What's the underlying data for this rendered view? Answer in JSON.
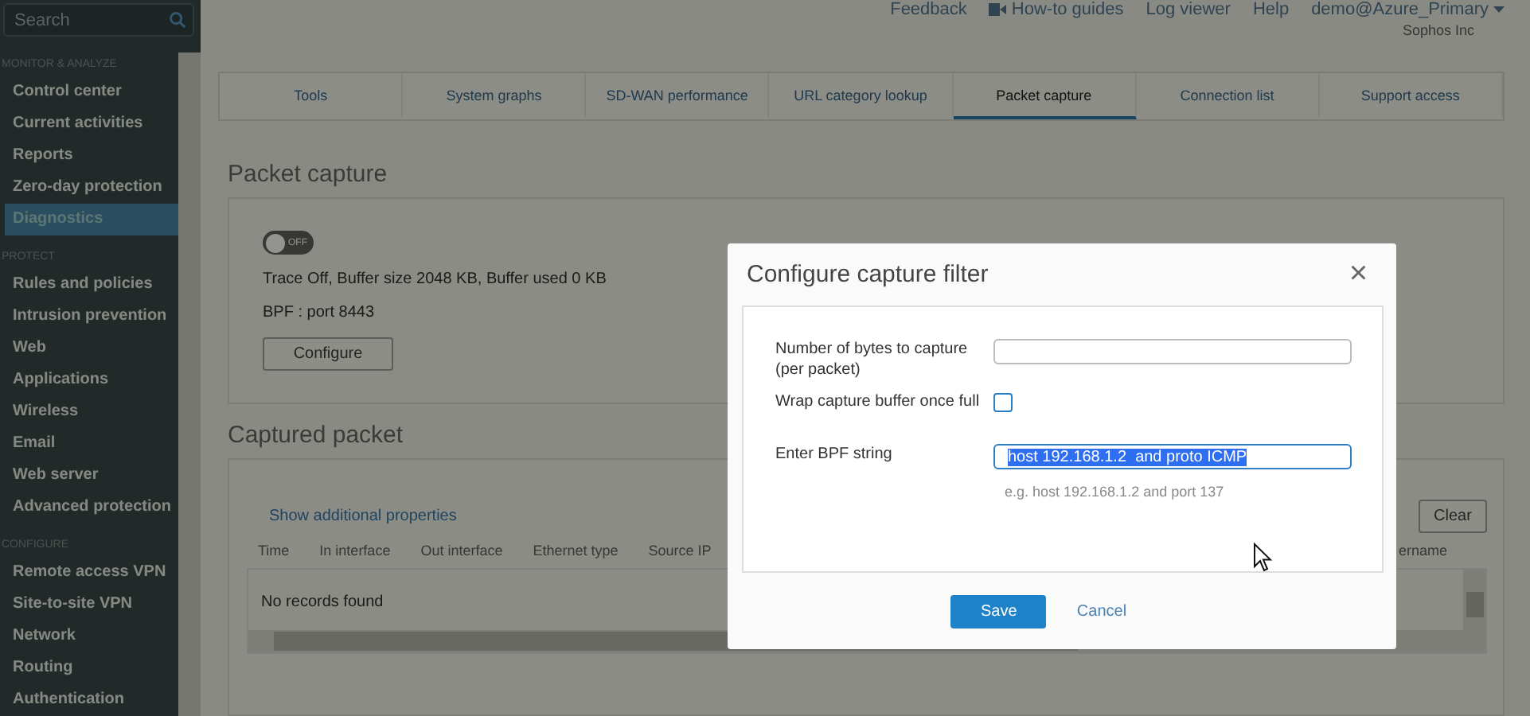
{
  "sidebar": {
    "search": {
      "placeholder": "Search"
    },
    "sections": [
      {
        "label": "MONITOR & ANALYZE",
        "items": [
          {
            "label": "Control center",
            "selected": false
          },
          {
            "label": "Current activities",
            "selected": false
          },
          {
            "label": "Reports",
            "selected": false
          },
          {
            "label": "Zero-day protection",
            "selected": false
          },
          {
            "label": "Diagnostics",
            "selected": true
          }
        ]
      },
      {
        "label": "PROTECT",
        "items": [
          {
            "label": "Rules and policies",
            "selected": false
          },
          {
            "label": "Intrusion prevention",
            "selected": false
          },
          {
            "label": "Web",
            "selected": false
          },
          {
            "label": "Applications",
            "selected": false
          },
          {
            "label": "Wireless",
            "selected": false
          },
          {
            "label": "Email",
            "selected": false
          },
          {
            "label": "Web server",
            "selected": false
          },
          {
            "label": "Advanced protection",
            "selected": false
          }
        ]
      },
      {
        "label": "CONFIGURE",
        "items": [
          {
            "label": "Remote access VPN",
            "selected": false
          },
          {
            "label": "Site-to-site VPN",
            "selected": false
          },
          {
            "label": "Network",
            "selected": false
          },
          {
            "label": "Routing",
            "selected": false
          },
          {
            "label": "Authentication",
            "selected": false
          }
        ]
      }
    ]
  },
  "top_links": [
    {
      "label": "Feedback",
      "kind": "plain"
    },
    {
      "label": "How-to guides",
      "kind": "video"
    },
    {
      "label": "Log viewer",
      "kind": "plain"
    },
    {
      "label": "Help",
      "kind": "plain"
    },
    {
      "label": "demo@Azure_Primary",
      "kind": "menu"
    }
  ],
  "company": "Sophos Inc",
  "tabs": [
    {
      "label": "Tools",
      "selected": false
    },
    {
      "label": "System graphs",
      "selected": false
    },
    {
      "label": "SD-WAN performance",
      "selected": false
    },
    {
      "label": "URL category lookup",
      "selected": false
    },
    {
      "label": "Packet capture",
      "selected": true
    },
    {
      "label": "Connection list",
      "selected": false
    },
    {
      "label": "Support access",
      "selected": false
    }
  ],
  "packet_capture": {
    "title": "Packet capture",
    "toggle": {
      "on": false,
      "label": "OFF"
    },
    "status": "Trace Off, Buffer size 2048 KB, Buffer used 0 KB",
    "bpf": "BPF : port 8443",
    "button": "Configure"
  },
  "captured_packet": {
    "title": "Captured packet",
    "link": "Show additional properties",
    "clear": "Clear",
    "columns": [
      "Time",
      "In interface",
      "Out interface",
      "Ethernet type",
      "Source IP",
      "ername"
    ],
    "empty": "No records found"
  },
  "dialog": {
    "title": "Configure capture filter",
    "close": "×",
    "fields": [
      {
        "kind": "text",
        "label": "Number of bytes to capture (per packet)",
        "highlighted": false
      },
      {
        "kind": "checkbox",
        "label": "Wrap capture buffer once full",
        "checked": false
      },
      {
        "kind": "text",
        "label": "Enter BPF string",
        "value": "host 192.168.1.2  and proto ICMP",
        "highlighted": true,
        "hint": "e.g. host 192.168.1.2 and port 137"
      }
    ],
    "save": "Save",
    "cancel": "Cancel"
  }
}
